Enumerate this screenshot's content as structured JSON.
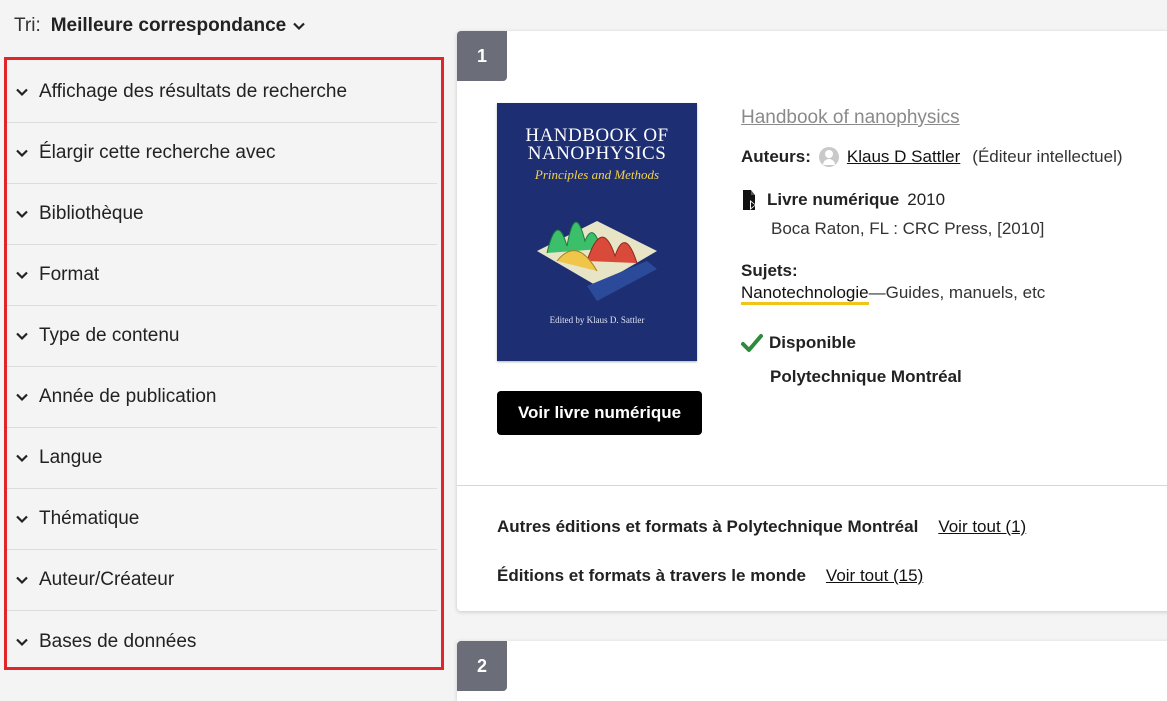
{
  "sort": {
    "label": "Tri:",
    "value": "Meilleure correspondance"
  },
  "facets": [
    {
      "label": "Affichage des résultats de recherche"
    },
    {
      "label": "Élargir cette recherche avec"
    },
    {
      "label": "Bibliothèque"
    },
    {
      "label": "Format"
    },
    {
      "label": "Type de contenu"
    },
    {
      "label": "Année de publication"
    },
    {
      "label": "Langue"
    },
    {
      "label": "Thématique"
    },
    {
      "label": "Auteur/Créateur"
    },
    {
      "label": "Bases de données"
    }
  ],
  "result1": {
    "number": "1",
    "cover": {
      "title": "HANDBOOK OF NANOPHYSICS",
      "subtitle": "Principles and Methods",
      "editor": "Edited by Klaus D. Sattler"
    },
    "title": "Handbook of nanophysics",
    "authors_label": "Auteurs:",
    "author": "Klaus D Sattler",
    "author_role": "(Éditeur intellectuel)",
    "format": "Livre numérique",
    "year": "2010",
    "publication": "Boca Raton, FL : CRC Press, [2010]",
    "subjects_label": "Sujets:",
    "subject_link": "Nanotechnologie",
    "subject_rest": "—Guides, manuels, etc",
    "availability": "Disponible",
    "library": "Polytechnique Montréal",
    "cta": "Voir livre numérique",
    "editions_local_label": "Autres éditions et formats à Polytechnique Montréal",
    "editions_local_link": "Voir tout (1)",
    "editions_world_label": "Éditions et formats à travers le monde",
    "editions_world_link": "Voir tout (15)"
  },
  "result2": {
    "number": "2"
  },
  "colors": {
    "accent_border": "#e0262b",
    "badge": "#6b6d78",
    "cta_bg": "#000000",
    "available": "#2e8b3d",
    "subject_underline": "#f0c419"
  }
}
